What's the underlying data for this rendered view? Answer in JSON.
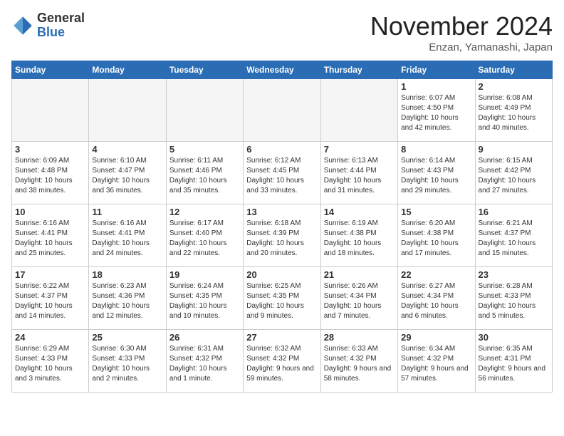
{
  "header": {
    "logo_general": "General",
    "logo_blue": "Blue",
    "month_title": "November 2024",
    "location": "Enzan, Yamanashi, Japan"
  },
  "days_of_week": [
    "Sunday",
    "Monday",
    "Tuesday",
    "Wednesday",
    "Thursday",
    "Friday",
    "Saturday"
  ],
  "weeks": [
    [
      {
        "day": "",
        "empty": true
      },
      {
        "day": "",
        "empty": true
      },
      {
        "day": "",
        "empty": true
      },
      {
        "day": "",
        "empty": true
      },
      {
        "day": "",
        "empty": true
      },
      {
        "day": "1",
        "sunrise": "Sunrise: 6:07 AM",
        "sunset": "Sunset: 4:50 PM",
        "daylight": "Daylight: 10 hours and 42 minutes."
      },
      {
        "day": "2",
        "sunrise": "Sunrise: 6:08 AM",
        "sunset": "Sunset: 4:49 PM",
        "daylight": "Daylight: 10 hours and 40 minutes."
      }
    ],
    [
      {
        "day": "3",
        "sunrise": "Sunrise: 6:09 AM",
        "sunset": "Sunset: 4:48 PM",
        "daylight": "Daylight: 10 hours and 38 minutes."
      },
      {
        "day": "4",
        "sunrise": "Sunrise: 6:10 AM",
        "sunset": "Sunset: 4:47 PM",
        "daylight": "Daylight: 10 hours and 36 minutes."
      },
      {
        "day": "5",
        "sunrise": "Sunrise: 6:11 AM",
        "sunset": "Sunset: 4:46 PM",
        "daylight": "Daylight: 10 hours and 35 minutes."
      },
      {
        "day": "6",
        "sunrise": "Sunrise: 6:12 AM",
        "sunset": "Sunset: 4:45 PM",
        "daylight": "Daylight: 10 hours and 33 minutes."
      },
      {
        "day": "7",
        "sunrise": "Sunrise: 6:13 AM",
        "sunset": "Sunset: 4:44 PM",
        "daylight": "Daylight: 10 hours and 31 minutes."
      },
      {
        "day": "8",
        "sunrise": "Sunrise: 6:14 AM",
        "sunset": "Sunset: 4:43 PM",
        "daylight": "Daylight: 10 hours and 29 minutes."
      },
      {
        "day": "9",
        "sunrise": "Sunrise: 6:15 AM",
        "sunset": "Sunset: 4:42 PM",
        "daylight": "Daylight: 10 hours and 27 minutes."
      }
    ],
    [
      {
        "day": "10",
        "sunrise": "Sunrise: 6:16 AM",
        "sunset": "Sunset: 4:41 PM",
        "daylight": "Daylight: 10 hours and 25 minutes."
      },
      {
        "day": "11",
        "sunrise": "Sunrise: 6:16 AM",
        "sunset": "Sunset: 4:41 PM",
        "daylight": "Daylight: 10 hours and 24 minutes."
      },
      {
        "day": "12",
        "sunrise": "Sunrise: 6:17 AM",
        "sunset": "Sunset: 4:40 PM",
        "daylight": "Daylight: 10 hours and 22 minutes."
      },
      {
        "day": "13",
        "sunrise": "Sunrise: 6:18 AM",
        "sunset": "Sunset: 4:39 PM",
        "daylight": "Daylight: 10 hours and 20 minutes."
      },
      {
        "day": "14",
        "sunrise": "Sunrise: 6:19 AM",
        "sunset": "Sunset: 4:38 PM",
        "daylight": "Daylight: 10 hours and 18 minutes."
      },
      {
        "day": "15",
        "sunrise": "Sunrise: 6:20 AM",
        "sunset": "Sunset: 4:38 PM",
        "daylight": "Daylight: 10 hours and 17 minutes."
      },
      {
        "day": "16",
        "sunrise": "Sunrise: 6:21 AM",
        "sunset": "Sunset: 4:37 PM",
        "daylight": "Daylight: 10 hours and 15 minutes."
      }
    ],
    [
      {
        "day": "17",
        "sunrise": "Sunrise: 6:22 AM",
        "sunset": "Sunset: 4:37 PM",
        "daylight": "Daylight: 10 hours and 14 minutes."
      },
      {
        "day": "18",
        "sunrise": "Sunrise: 6:23 AM",
        "sunset": "Sunset: 4:36 PM",
        "daylight": "Daylight: 10 hours and 12 minutes."
      },
      {
        "day": "19",
        "sunrise": "Sunrise: 6:24 AM",
        "sunset": "Sunset: 4:35 PM",
        "daylight": "Daylight: 10 hours and 10 minutes."
      },
      {
        "day": "20",
        "sunrise": "Sunrise: 6:25 AM",
        "sunset": "Sunset: 4:35 PM",
        "daylight": "Daylight: 10 hours and 9 minutes."
      },
      {
        "day": "21",
        "sunrise": "Sunrise: 6:26 AM",
        "sunset": "Sunset: 4:34 PM",
        "daylight": "Daylight: 10 hours and 7 minutes."
      },
      {
        "day": "22",
        "sunrise": "Sunrise: 6:27 AM",
        "sunset": "Sunset: 4:34 PM",
        "daylight": "Daylight: 10 hours and 6 minutes."
      },
      {
        "day": "23",
        "sunrise": "Sunrise: 6:28 AM",
        "sunset": "Sunset: 4:33 PM",
        "daylight": "Daylight: 10 hours and 5 minutes."
      }
    ],
    [
      {
        "day": "24",
        "sunrise": "Sunrise: 6:29 AM",
        "sunset": "Sunset: 4:33 PM",
        "daylight": "Daylight: 10 hours and 3 minutes."
      },
      {
        "day": "25",
        "sunrise": "Sunrise: 6:30 AM",
        "sunset": "Sunset: 4:33 PM",
        "daylight": "Daylight: 10 hours and 2 minutes."
      },
      {
        "day": "26",
        "sunrise": "Sunrise: 6:31 AM",
        "sunset": "Sunset: 4:32 PM",
        "daylight": "Daylight: 10 hours and 1 minute."
      },
      {
        "day": "27",
        "sunrise": "Sunrise: 6:32 AM",
        "sunset": "Sunset: 4:32 PM",
        "daylight": "Daylight: 9 hours and 59 minutes."
      },
      {
        "day": "28",
        "sunrise": "Sunrise: 6:33 AM",
        "sunset": "Sunset: 4:32 PM",
        "daylight": "Daylight: 9 hours and 58 minutes."
      },
      {
        "day": "29",
        "sunrise": "Sunrise: 6:34 AM",
        "sunset": "Sunset: 4:32 PM",
        "daylight": "Daylight: 9 hours and 57 minutes."
      },
      {
        "day": "30",
        "sunrise": "Sunrise: 6:35 AM",
        "sunset": "Sunset: 4:31 PM",
        "daylight": "Daylight: 9 hours and 56 minutes."
      }
    ]
  ]
}
